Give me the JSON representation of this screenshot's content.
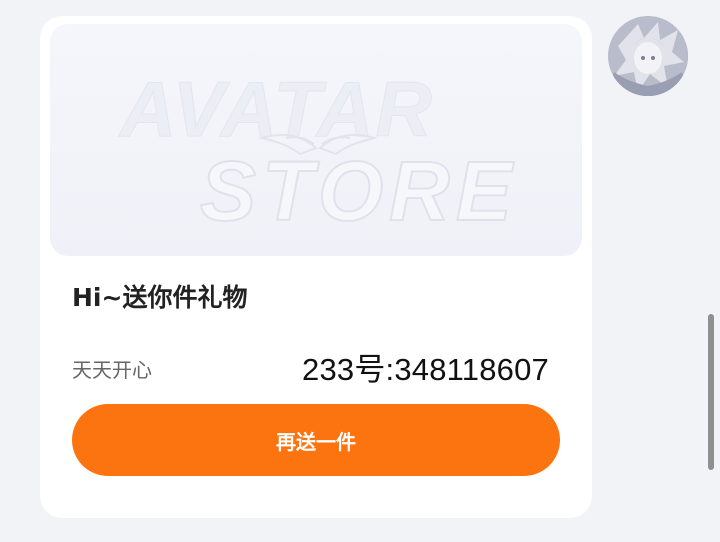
{
  "gift_card": {
    "banner": {
      "logo_line1": "AVATAR",
      "logo_line2": "STORE"
    },
    "title": "Hi~送你件礼物",
    "subtitle": "天天开心",
    "overlay_text": "233号:348118607",
    "send_again_label": "再送一件"
  },
  "colors": {
    "accent": "#fb7410",
    "page_background": "#f2f3f7",
    "card_background": "#ffffff"
  },
  "avatar": {
    "icon": "user-avatar-image"
  }
}
